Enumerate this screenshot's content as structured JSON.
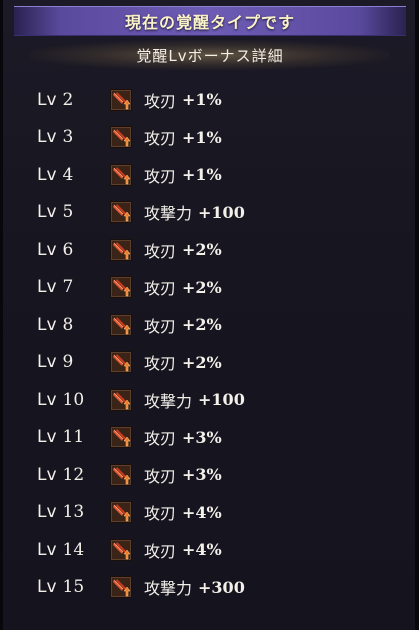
{
  "header": {
    "type_label": "現在の覚醒タイプです",
    "section_title": "覚醒Lvボーナス詳細"
  },
  "level_prefix": "Lv",
  "icon": "sword-up-arrow-icon",
  "colors": {
    "banner": "#6d5cb4",
    "icon_bg": "#3a2418",
    "icon_blade": "#e0542e",
    "icon_arrow": "#f07a2a"
  },
  "bonuses": [
    {
      "level": "2",
      "name": "攻刃",
      "value": "+1%"
    },
    {
      "level": "3",
      "name": "攻刃",
      "value": "+1%"
    },
    {
      "level": "4",
      "name": "攻刃",
      "value": "+1%"
    },
    {
      "level": "5",
      "name": "攻撃力",
      "value": "+100"
    },
    {
      "level": "6",
      "name": "攻刃",
      "value": "+2%"
    },
    {
      "level": "7",
      "name": "攻刃",
      "value": "+2%"
    },
    {
      "level": "8",
      "name": "攻刃",
      "value": "+2%"
    },
    {
      "level": "9",
      "name": "攻刃",
      "value": "+2%"
    },
    {
      "level": "10",
      "name": "攻撃力",
      "value": "+100"
    },
    {
      "level": "11",
      "name": "攻刃",
      "value": "+3%"
    },
    {
      "level": "12",
      "name": "攻刃",
      "value": "+3%"
    },
    {
      "level": "13",
      "name": "攻刃",
      "value": "+4%"
    },
    {
      "level": "14",
      "name": "攻刃",
      "value": "+4%"
    },
    {
      "level": "15",
      "name": "攻撃力",
      "value": "+300"
    }
  ]
}
